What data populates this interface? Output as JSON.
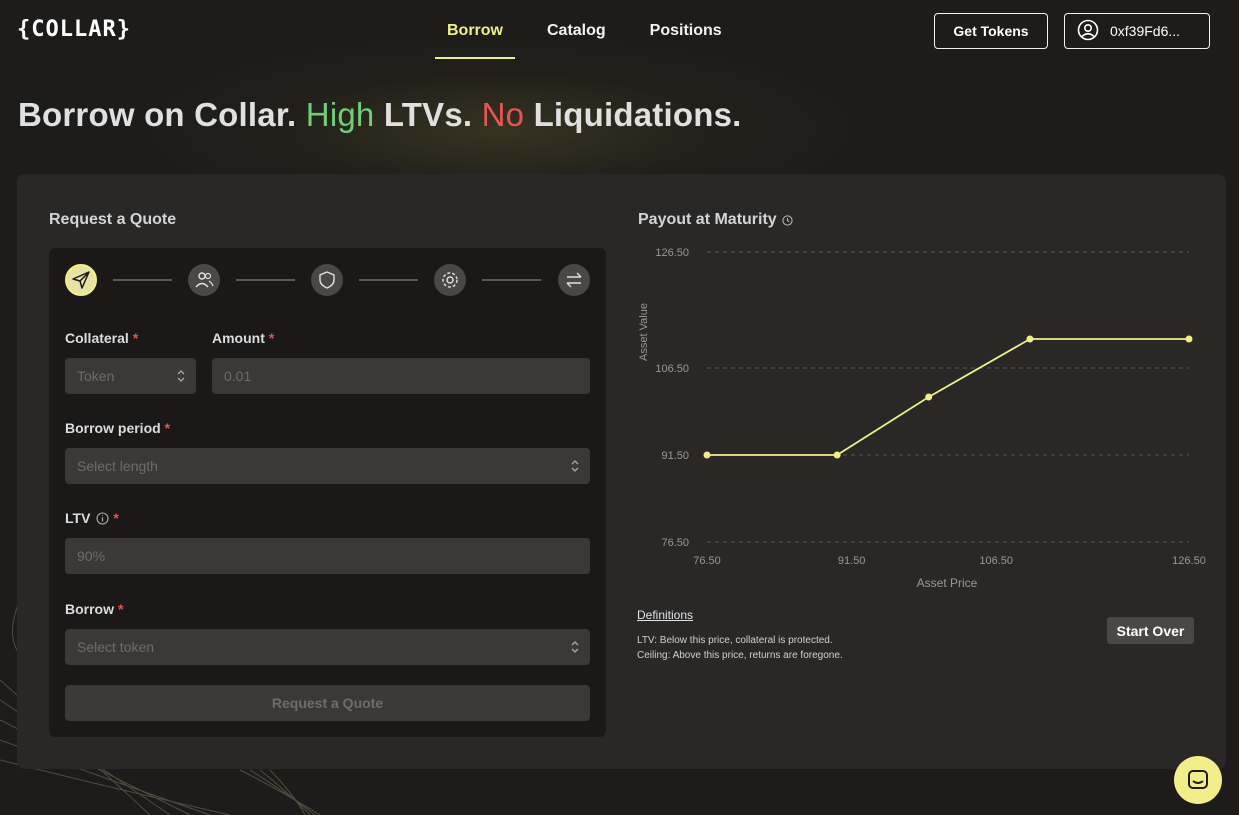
{
  "brand": {
    "logo": "{COLLAR}"
  },
  "nav": {
    "tabs": [
      {
        "label": "Borrow",
        "active": true
      },
      {
        "label": "Catalog",
        "active": false
      },
      {
        "label": "Positions",
        "active": false
      }
    ],
    "get_tokens": "Get Tokens",
    "wallet": "0xf39Fd6..."
  },
  "headline": {
    "part1": "Borrow on Collar. ",
    "high": "High",
    "part2": " LTVs. ",
    "no": "No",
    "part3": " Liquidations."
  },
  "quote": {
    "title": "Request a Quote",
    "steps": [
      "send-icon",
      "users-icon",
      "shield-icon",
      "gear-icon",
      "swap-icon"
    ],
    "collateral": {
      "label": "Collateral",
      "placeholder": "Token"
    },
    "amount": {
      "label": "Amount",
      "placeholder": "0.01"
    },
    "borrow_period": {
      "label": "Borrow period",
      "placeholder": "Select length"
    },
    "ltv": {
      "label": "LTV",
      "placeholder": "90%"
    },
    "borrow": {
      "label": "Borrow",
      "placeholder": "Select token"
    },
    "required_mark": "*",
    "submit": "Request a Quote"
  },
  "payout": {
    "title": "Payout at Maturity",
    "definitions_link": "Definitions",
    "definitions": [
      "LTV: Below this price, collateral is protected.",
      "Ceiling: Above this price, returns are foregone."
    ],
    "start_over": "Start Over"
  },
  "chart_data": {
    "type": "line",
    "title": "Payout at Maturity",
    "xlabel": "Asset Price",
    "ylabel": "Asset Value",
    "x_ticks": [
      "76.50",
      "91.50",
      "106.50",
      "126.50"
    ],
    "y_ticks": [
      "126.50",
      "106.50",
      "91.50",
      "76.50"
    ],
    "xlim": [
      76.5,
      126.5
    ],
    "ylim": [
      76.5,
      126.5
    ],
    "grid": true,
    "line_color": "#f2ef8a",
    "series": [
      {
        "points": [
          {
            "x": 76.5,
            "y": 91.5
          },
          {
            "x": 90.0,
            "y": 91.5
          },
          {
            "x": 99.5,
            "y": 101.5
          },
          {
            "x": 110.0,
            "y": 111.5
          },
          {
            "x": 126.5,
            "y": 111.5
          }
        ]
      }
    ]
  },
  "colors": {
    "accent": "#f2ef8a",
    "green": "#6fce78",
    "red": "#e85454"
  }
}
